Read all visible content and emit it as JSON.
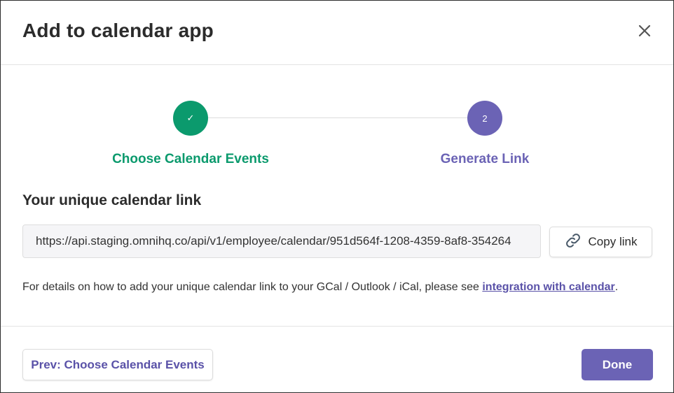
{
  "dialog": {
    "title": "Add to calendar app",
    "close_icon": "close-icon"
  },
  "stepper": {
    "steps": [
      {
        "label": "Choose Calendar Events",
        "indicator": "✓",
        "status": "completed",
        "color": "#0b9a6d"
      },
      {
        "label": "Generate Link",
        "indicator": "2",
        "status": "active",
        "color": "#6b63b5"
      }
    ]
  },
  "link_section": {
    "title": "Your unique calendar link",
    "link_value": "https://api.staging.omnihq.co/api/v1/employee/calendar/951d564f-1208-4359-8af8-354264",
    "copy_label": "Copy link",
    "copy_icon": "link-icon"
  },
  "details": {
    "text": "For details on how to add your unique calendar link to your GCal / Outlook / iCal, please see ",
    "link_text": "integration with calendar",
    "suffix": "."
  },
  "footer": {
    "prev_label": "Prev: Choose Calendar Events",
    "done_label": "Done"
  },
  "colors": {
    "accent": "#6b63b5",
    "success": "#0b9a6d"
  }
}
